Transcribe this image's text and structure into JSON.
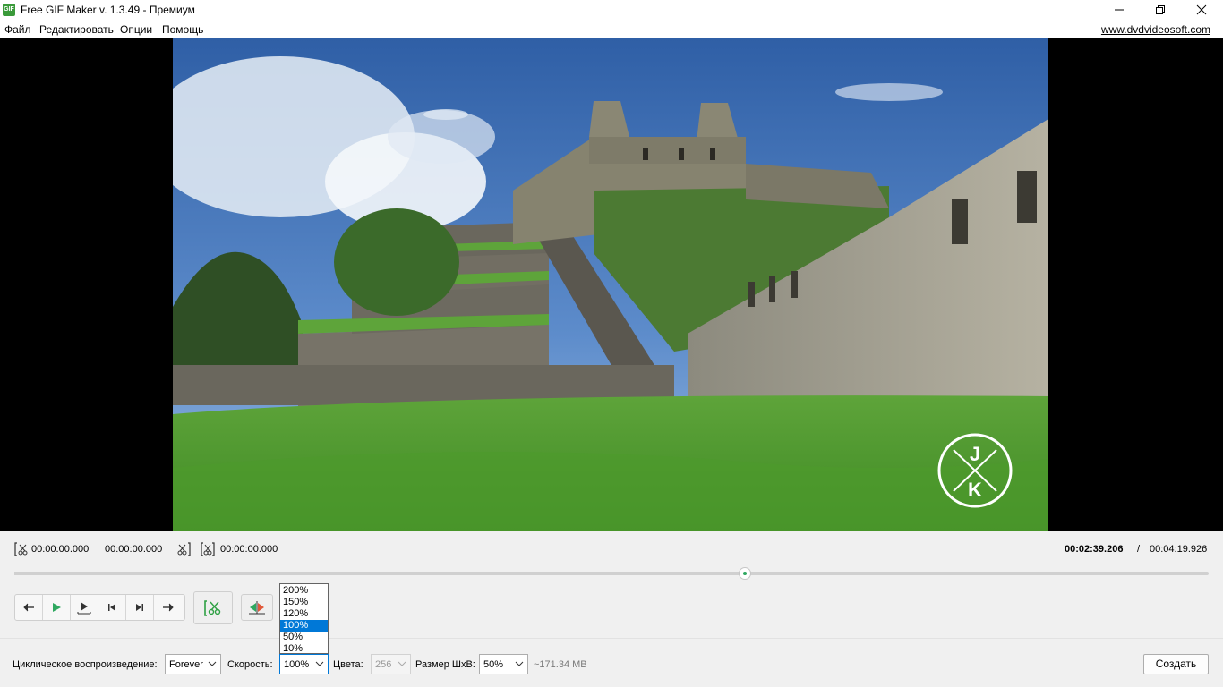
{
  "window": {
    "title": "Free GIF Maker v. 1.3.49 - Премиум",
    "icon_label": "GIF",
    "controls": {
      "minimize": "minimize-icon",
      "maximize": "restore-icon",
      "close": "close-icon"
    }
  },
  "menu": {
    "items": [
      "Файл",
      "Редактировать",
      "Опции",
      "Помощь"
    ],
    "link": "www.dvdvideosoft.com"
  },
  "video": {
    "watermark_top": "J",
    "watermark_bottom": "K"
  },
  "timeline": {
    "start_time": "00:00:00.000",
    "end_time": "00:00:00.000",
    "cut_time": "00:00:00.000",
    "current_time": "00:02:39.206",
    "separator": "/",
    "total_time": "00:04:19.926",
    "position_fraction": 0.612
  },
  "controls": {
    "buttons": [
      "back-arrow-icon",
      "play-icon",
      "next-frame-icon",
      "skip-start-icon",
      "skip-end-icon",
      "forward-arrow-icon"
    ],
    "cut_button": "scissors-icon",
    "flip_button": "flip-icon"
  },
  "bottom": {
    "loop_label": "Циклическое воспроизведение:",
    "loop_value": "Forever",
    "speed_label": "Скорость:",
    "speed_value": "100%",
    "colors_label": "Цвета:",
    "colors_value": "256",
    "size_label": "Размер ШxВ:",
    "size_value": "50%",
    "file_size": "~171.34 MB",
    "create_label": "Создать"
  },
  "speed_dropdown": {
    "options": [
      "200%",
      "150%",
      "120%",
      "100%",
      "50%",
      "10%"
    ],
    "selected": "100%"
  },
  "colors": {
    "accent": "#0078d7",
    "seek_green": "#2fa860",
    "cut_green": "#2ea043"
  }
}
